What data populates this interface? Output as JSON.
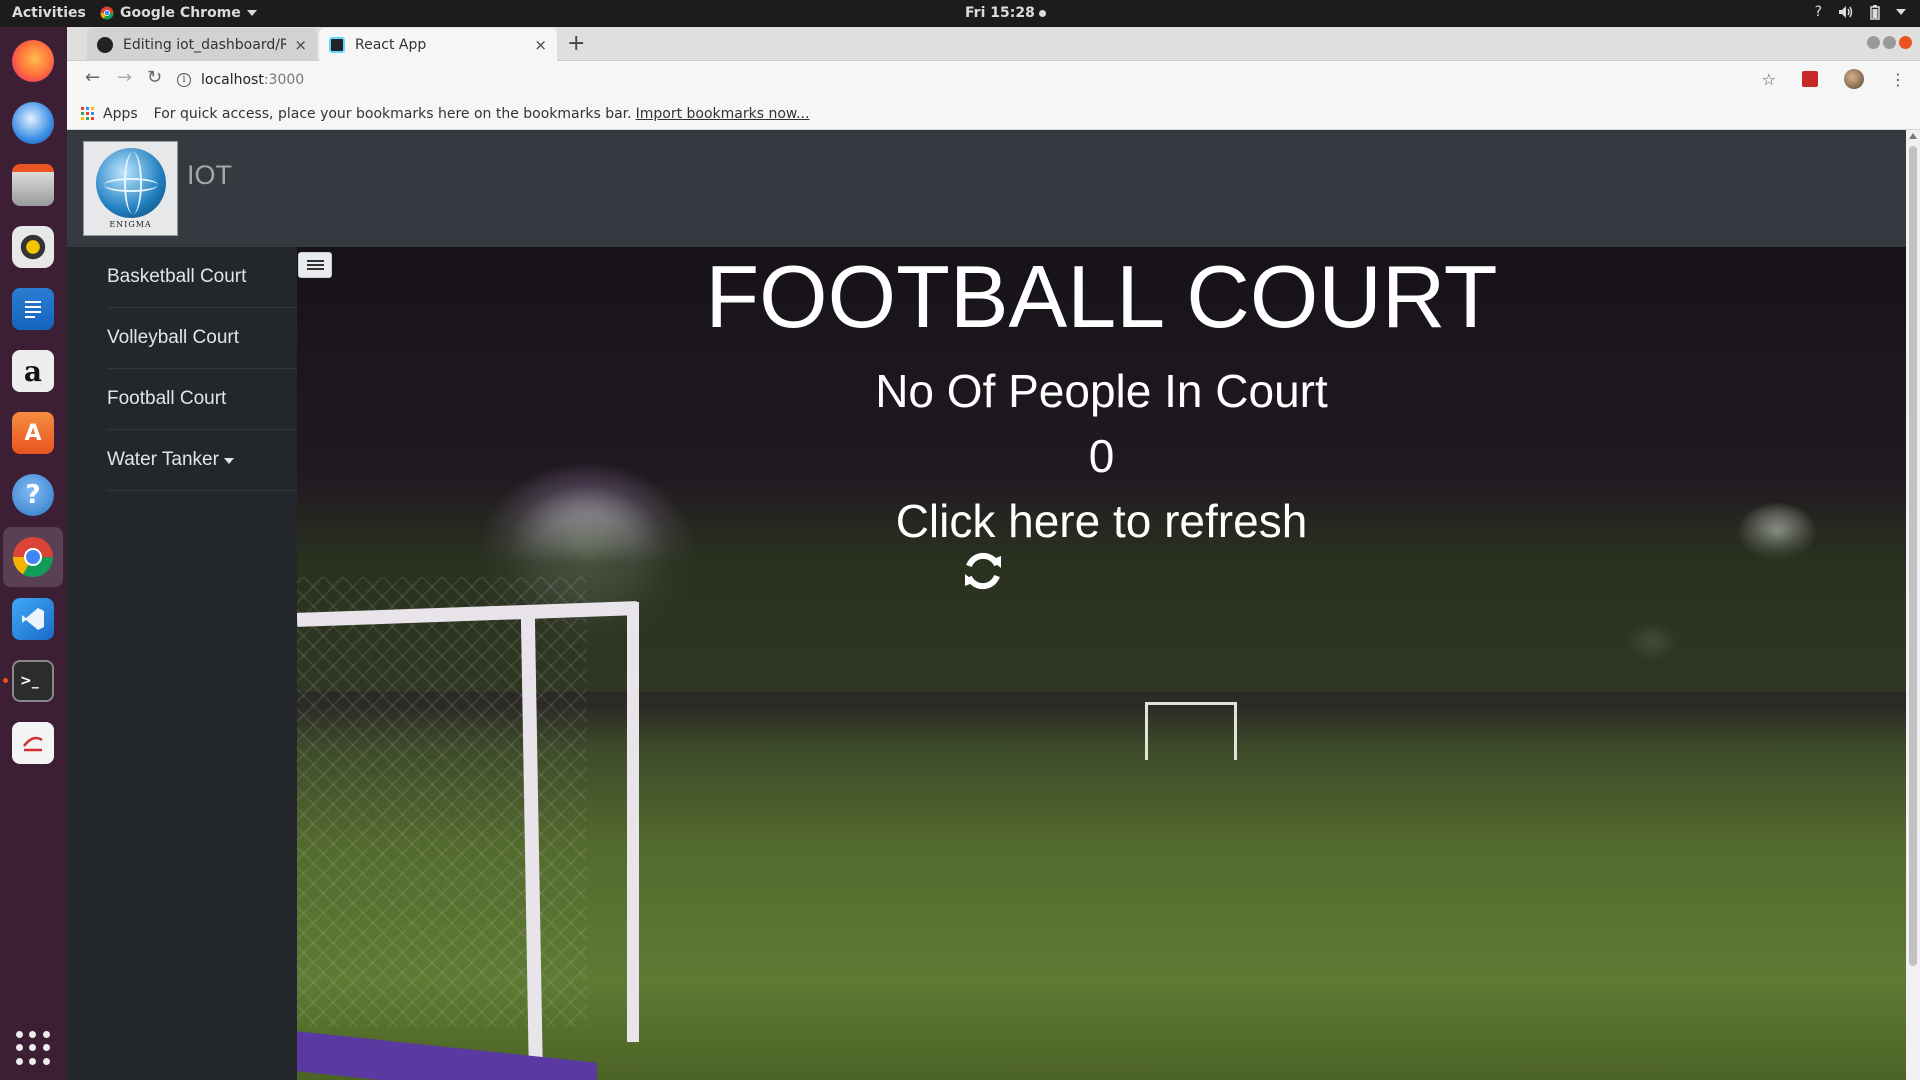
{
  "os": {
    "activities": "Activities",
    "app_menu": "Google Chrome",
    "clock": "Fri 15:28",
    "tray_help": "?"
  },
  "browser": {
    "tabs": [
      {
        "title": "Editing iot_dashboard/RE",
        "close": "×"
      },
      {
        "title": "React App",
        "close": "×"
      }
    ],
    "new_tab": "+",
    "address_host": "localhost",
    "address_port": ":3000",
    "bookmarks": {
      "apps": "Apps",
      "hint": "For quick access, place your bookmarks here on the bookmarks bar.",
      "import_link": "Import bookmarks now..."
    }
  },
  "app": {
    "logo_text": "ENIGMA",
    "brand": "IOT",
    "sidebar": [
      {
        "label": "Basketball Court"
      },
      {
        "label": "Volleyball Court"
      },
      {
        "label": "Football Court"
      },
      {
        "label": "Water Tanker",
        "dropdown": true
      }
    ],
    "page_title": "FOOTBALL COURT",
    "people_label": "No Of People In Court",
    "people_count": "0",
    "refresh_label": "Click here to refresh"
  },
  "icons": {
    "dock": [
      "firefox-icon",
      "thunderbird-icon",
      "files-icon",
      "rhythmbox-icon",
      "writer-icon",
      "amazon-icon",
      "software-icon",
      "help-icon",
      "chrome-icon",
      "vscode-icon",
      "terminal-icon",
      "text-editor-icon",
      "show-apps-icon"
    ],
    "refresh": "refresh-icon",
    "toggle": "list-icon"
  },
  "colors": {
    "navbar": "#343a40",
    "sidebar": "#23272b",
    "dock": "#3c1f35",
    "accent": "#e95420"
  }
}
